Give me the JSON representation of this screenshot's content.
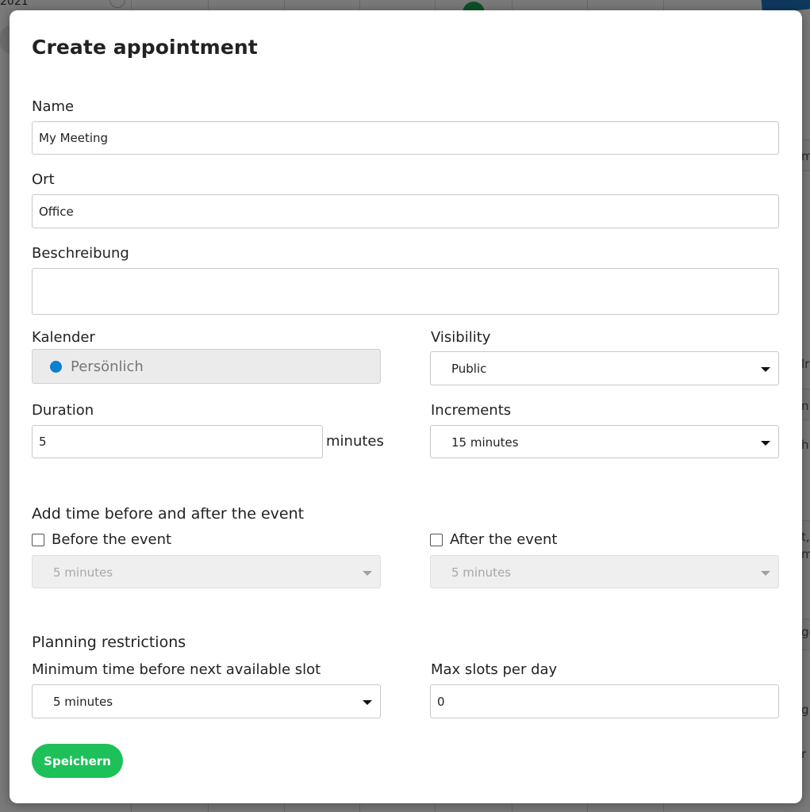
{
  "background": {
    "year_fragment": "2021",
    "side_letters": [
      "m",
      "lr",
      "n",
      "hi",
      "t,",
      "m",
      "ge",
      "g",
      "r"
    ]
  },
  "modal": {
    "title": "Create appointment",
    "fields": {
      "name": {
        "label": "Name",
        "value": "My Meeting"
      },
      "location": {
        "label": "Ort",
        "value": "Office"
      },
      "description": {
        "label": "Beschreibung",
        "value": ""
      },
      "calendar": {
        "label": "Kalender",
        "value": "Persönlich",
        "dot_color": "#0f7fcf"
      },
      "visibility": {
        "label": "Visibility",
        "value": "Public"
      },
      "duration": {
        "label": "Duration",
        "value": "5",
        "unit": "minutes"
      },
      "increments": {
        "label": "Increments",
        "value": "15 minutes"
      }
    },
    "buffer_section": {
      "heading": "Add time before and after the event",
      "before": {
        "label": "Before the event",
        "checked": false,
        "value": "5 minutes"
      },
      "after": {
        "label": "After the event",
        "checked": false,
        "value": "5 minutes"
      }
    },
    "restrictions_section": {
      "heading": "Planning restrictions",
      "min_time": {
        "label": "Minimum time before next available slot",
        "value": "5 minutes"
      },
      "max_slots": {
        "label": "Max slots per day",
        "value": "0"
      }
    },
    "save_label": "Speichern"
  },
  "colors": {
    "accent_green": "#1ec05a",
    "calendar_blue": "#0f7fcf"
  }
}
